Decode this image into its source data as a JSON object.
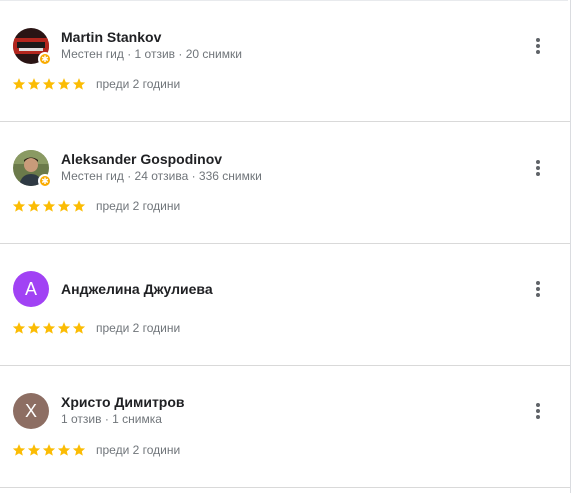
{
  "colors": {
    "star": "#fbbc04",
    "badge": "#f9ab00",
    "divider": "#d9d9d9",
    "avatar_purple": "#a142f4",
    "avatar_taupe": "#8d6e63"
  },
  "reviews": [
    {
      "name": "Martin Stankov",
      "meta": "Местен гид · 1 отзив · 20 снимки",
      "stars": 5,
      "time": "преди 2 години",
      "avatar_type": "photo",
      "local_guide": true
    },
    {
      "name": "Aleksander Gospodinov",
      "meta": "Местен гид · 24 отзива · 336 снимки",
      "stars": 5,
      "time": "преди 2 години",
      "avatar_type": "photo",
      "local_guide": true
    },
    {
      "name": "Анджелина Джулиева",
      "meta": "",
      "stars": 5,
      "time": "преди 2 години",
      "avatar_type": "letter",
      "avatar_letter": "A",
      "local_guide": false
    },
    {
      "name": "Христо Димитров",
      "meta": "1 отзив · 1 снимка",
      "stars": 5,
      "time": "преди 2 години",
      "avatar_type": "letter",
      "avatar_letter": "X",
      "local_guide": false
    }
  ]
}
